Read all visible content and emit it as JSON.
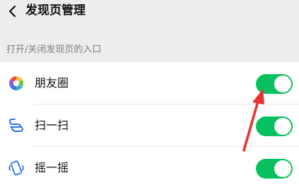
{
  "header": {
    "back_icon": "chevron-left-icon",
    "title": "发现页管理"
  },
  "section": {
    "label": "打开/关闭发现页的入口"
  },
  "items": [
    {
      "label": "朋友圈",
      "icon": "moments-aperture-icon",
      "enabled": true
    },
    {
      "label": "扫一扫",
      "icon": "scan-icon",
      "enabled": true
    },
    {
      "label": "摇一摇",
      "icon": "shake-icon",
      "enabled": true
    }
  ],
  "colors": {
    "toggle_on": "#07c160",
    "annotation_arrow": "#e8302f",
    "icon_blue": "#2f6fe8"
  }
}
